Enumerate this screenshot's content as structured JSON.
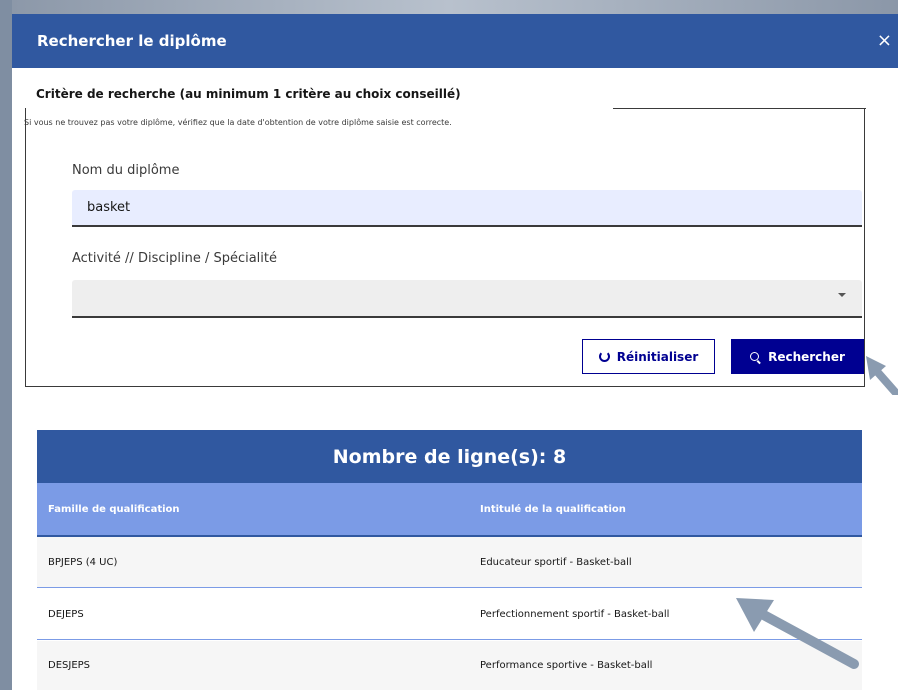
{
  "modal": {
    "title": "Rechercher le diplôme",
    "close_glyph": "×"
  },
  "criteria": {
    "title": "Critère de recherche (au minimum 1 critère au choix conseillé)",
    "hint": "Si vous ne trouvez pas votre diplôme, vérifiez que la date d'obtention de votre diplôme saisie est correcte.",
    "name_label": "Nom du diplôme",
    "name_value": "basket",
    "activity_label": "Activité // Discipline / Spécialité",
    "activity_value": "",
    "reset_label": "Réinitialiser",
    "search_label": "Rechercher"
  },
  "results": {
    "count_label": "Nombre de ligne(s): 8",
    "columns": [
      "Famille de qualification",
      "Intitulé de la qualification"
    ],
    "rows": [
      {
        "family": "BPJEPS (4 UC)",
        "title": "Educateur sportif - Basket-ball"
      },
      {
        "family": "DEJEPS",
        "title": "Perfectionnement sportif - Basket-ball"
      },
      {
        "family": "DESJEPS",
        "title": "Performance sportive - Basket-ball"
      }
    ]
  },
  "colors": {
    "header_blue": "#3058a0",
    "table_head_blue": "#7b9be6",
    "primary_button": "#000091",
    "arrow_gray": "#8a9bb0"
  }
}
